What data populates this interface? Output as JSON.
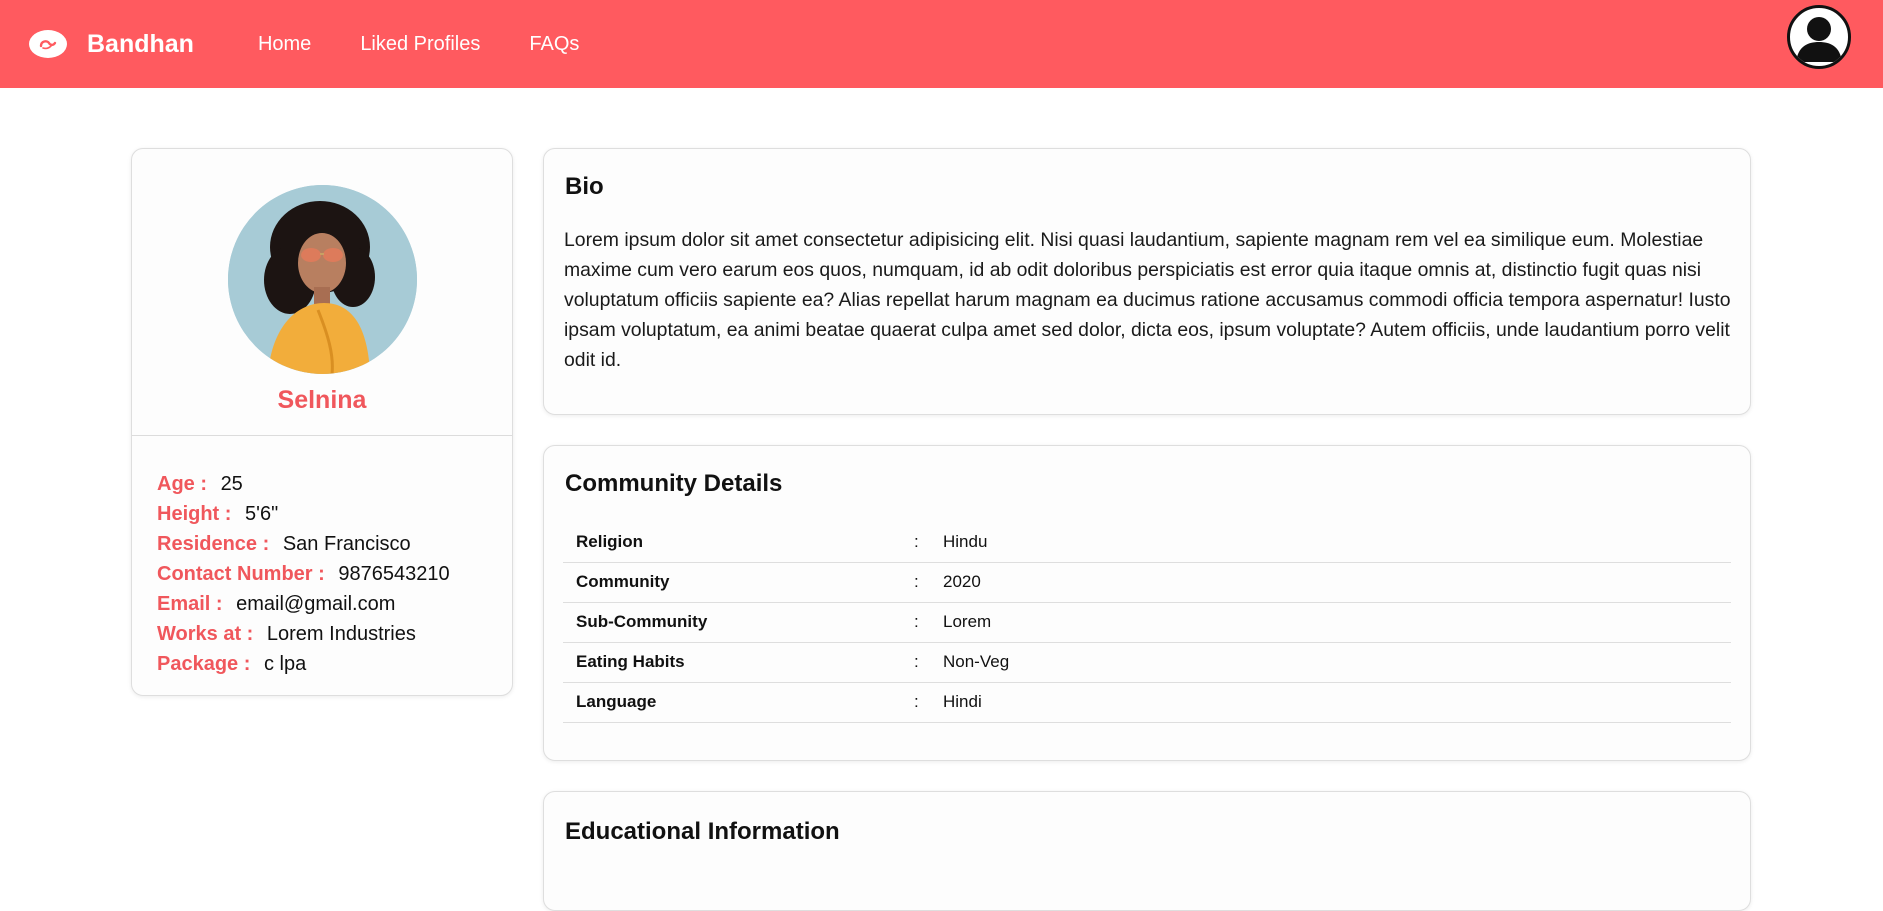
{
  "navbar": {
    "brand_name": "Bandhan",
    "links": [
      "Home",
      "Liked Profiles",
      "FAQs"
    ],
    "brand_color": "#ff5a5f"
  },
  "profile": {
    "name": "Selnina",
    "fields": [
      {
        "label": "Age :",
        "value": "25"
      },
      {
        "label": "Height :",
        "value": "5'6\""
      },
      {
        "label": "Residence :",
        "value": "San Francisco"
      },
      {
        "label": "Contact Number :",
        "value": "9876543210"
      },
      {
        "label": "Email :",
        "value": "email@gmail.com"
      },
      {
        "label": "Works at :",
        "value": "Lorem Industries"
      },
      {
        "label": "Package :",
        "value": "c lpa"
      }
    ]
  },
  "bio": {
    "title": "Bio",
    "text": "Lorem ipsum dolor sit amet consectetur adipisicing elit. Nisi quasi laudantium, sapiente magnam rem vel ea similique eum. Molestiae maxime cum vero earum eos quos, numquam, id ab odit doloribus perspiciatis est error quia itaque omnis at, distinctio fugit quas nisi voluptatum officiis sapiente ea? Alias repellat harum magnam ea ducimus ratione accusamus commodi officia tempora aspernatur! Iusto ipsam voluptatum, ea animi beatae quaerat culpa amet sed dolor, dicta eos, ipsum voluptate? Autem officiis, unde laudantium porro velit odit id."
  },
  "community": {
    "title": "Community Details",
    "rows": [
      {
        "key": "Religion",
        "sep": ":",
        "value": "Hindu"
      },
      {
        "key": "Community",
        "sep": ":",
        "value": "2020"
      },
      {
        "key": "Sub-Community",
        "sep": ":",
        "value": "Lorem"
      },
      {
        "key": "Eating Habits",
        "sep": ":",
        "value": "Non-Veg"
      },
      {
        "key": "Language",
        "sep": ":",
        "value": "Hindi"
      }
    ]
  },
  "education": {
    "title": "Educational Information"
  }
}
